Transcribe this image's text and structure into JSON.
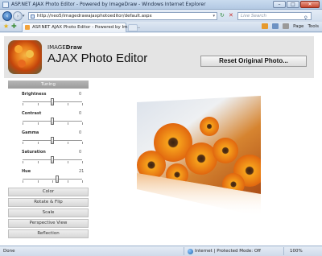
{
  "window": {
    "title": "ASP.NET AJAX Photo Editor - Powered by ImageDraw - Windows Internet Explorer"
  },
  "address_bar": {
    "url": "http://neo5/imagedrawajaxphotoeditor/default.aspx",
    "search_placeholder": "Live Search"
  },
  "tab": {
    "title": "ASP.NET AJAX Photo Editor - Powered by Image..."
  },
  "toolbar": {
    "page_label": "Page",
    "tools_label": "Tools"
  },
  "header": {
    "brand_prefix": "IMAGE",
    "brand_suffix": "Draw",
    "app_title": "AJAX Photo Editor",
    "reset_label": "Reset Original Photo..."
  },
  "sidebar": {
    "tuning_label": "Tuning",
    "sliders": [
      {
        "label": "Brightness",
        "value": "0",
        "level": 0.5
      },
      {
        "label": "Contrast",
        "value": "0",
        "level": 0.5
      },
      {
        "label": "Gamma",
        "value": "0",
        "level": 0.5
      },
      {
        "label": "Saturation",
        "value": "0",
        "level": 0.5
      },
      {
        "label": "Hue",
        "value": "21",
        "level": 0.58
      }
    ],
    "sections": [
      "Color",
      "Rotate & Flip",
      "Scale",
      "Perspective View",
      "Reflection"
    ]
  },
  "status_bar": {
    "status": "Done",
    "zone": "Internet | Protected Mode: Off",
    "zoom": "100%"
  },
  "colors": {
    "accent": "#f5a623",
    "tuning_header": "#a8a8a8"
  }
}
